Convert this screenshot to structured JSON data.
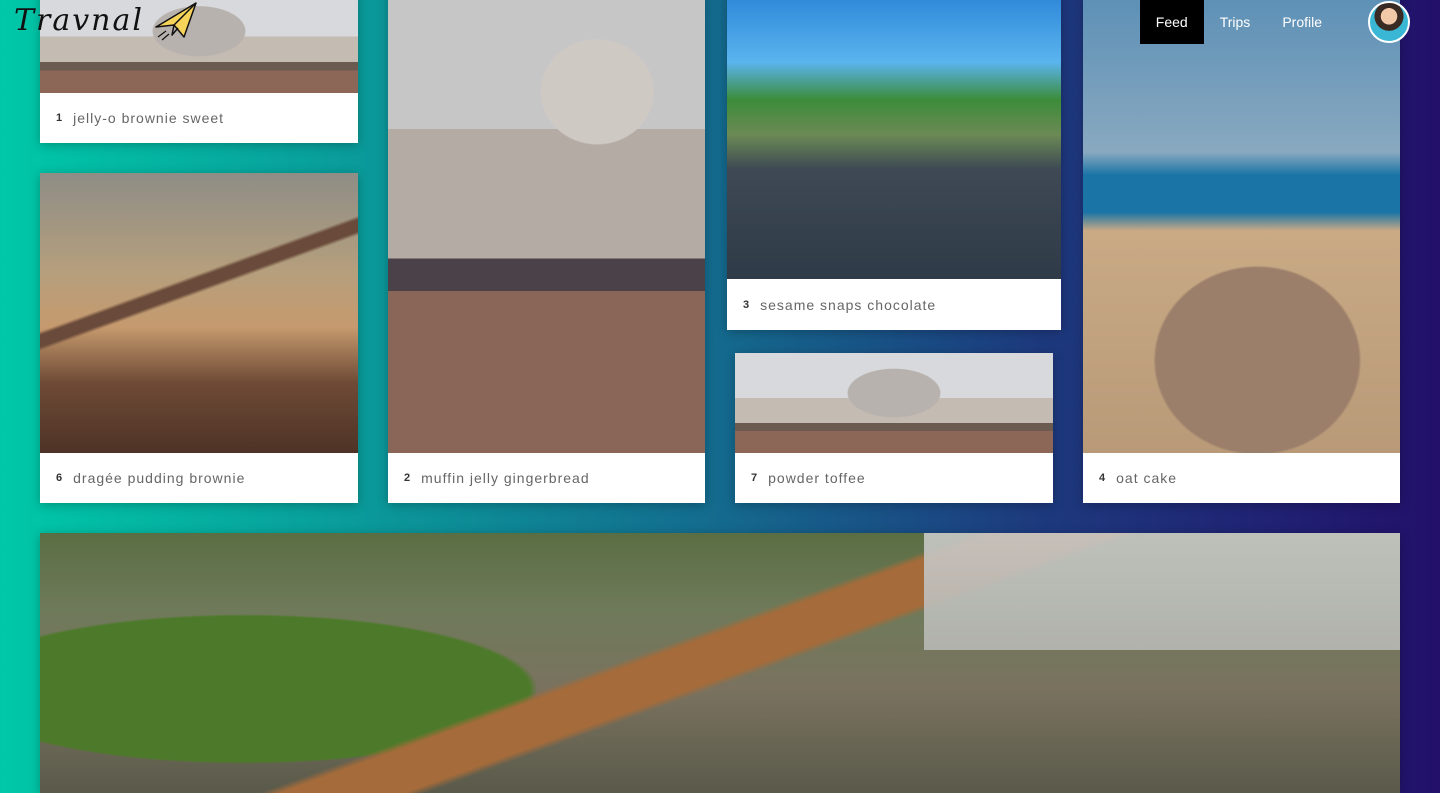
{
  "brand": {
    "name": "Travnal",
    "logo_icon": "paper-plane-icon"
  },
  "nav": {
    "items": [
      {
        "label": "Feed",
        "active": true
      },
      {
        "label": "Trips",
        "active": false
      },
      {
        "label": "Profile",
        "active": false
      }
    ],
    "avatar": "user-avatar"
  },
  "cards": [
    {
      "num": "1",
      "title": "jelly-o brownie sweet",
      "image": "taj-mahal-crowd"
    },
    {
      "num": "6",
      "title": "dragée pudding brownie",
      "image": "airplane-wing-sunset"
    },
    {
      "num": "2",
      "title": "muffin jelly gingerbread",
      "image": "taj-mahal-children"
    },
    {
      "num": "3",
      "title": "sesame snaps chocolate",
      "image": "forest-road"
    },
    {
      "num": "7",
      "title": "powder toffee",
      "image": "taj-mahal-crowd"
    },
    {
      "num": "4",
      "title": "oat cake",
      "image": "beach-hat"
    }
  ],
  "featured": {
    "image": "mountain-rope-bridge"
  },
  "colors": {
    "gradient_start": "#00c8a8",
    "gradient_end": "#22106a",
    "nav_active": "#000000"
  }
}
